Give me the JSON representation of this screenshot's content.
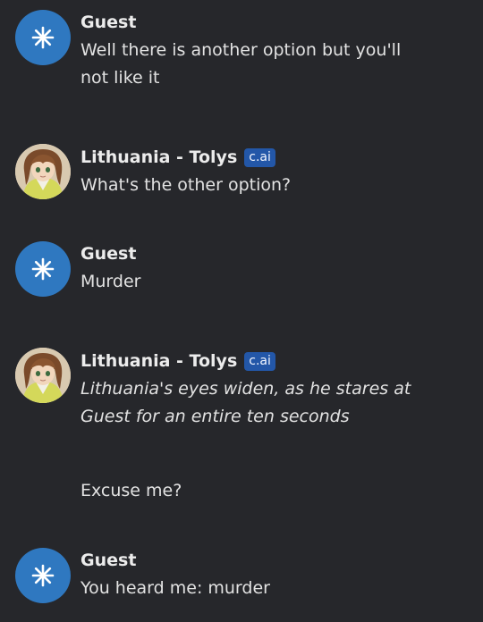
{
  "messages": [
    {
      "author": "Guest",
      "lines": [
        "Well there is another option but you'll",
        "not like it"
      ]
    },
    {
      "author": "Lithuania - Tolys",
      "badge": "c.ai",
      "lines": [
        "What's the other option?"
      ]
    },
    {
      "author": "Guest",
      "lines": [
        "Murder"
      ]
    },
    {
      "author": "Lithuania - Tolys",
      "badge": "c.ai",
      "italic_lines": [
        "Lithuania's eyes widen, as he stares at",
        "Guest for an entire ten seconds"
      ],
      "lines": [
        "Excuse me?"
      ]
    },
    {
      "author": "Guest",
      "lines": [
        "You heard me: murder"
      ]
    }
  ],
  "icons": {
    "guest_avatar": "star-burst-icon",
    "character_avatar": "character-portrait"
  },
  "colors": {
    "background": "#26272b",
    "guest_avatar": "#2f78c0",
    "badge": "#2357a8"
  }
}
